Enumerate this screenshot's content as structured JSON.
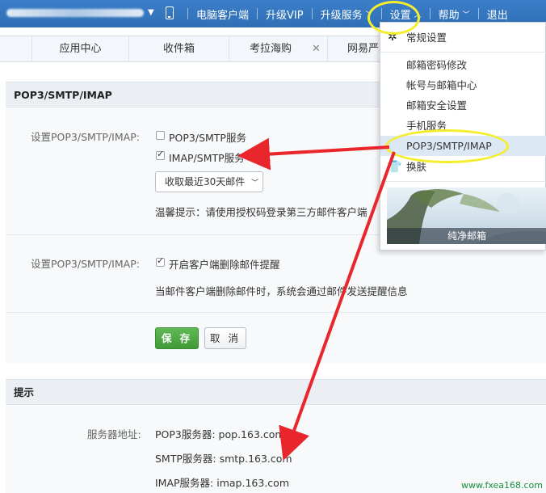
{
  "topbar": {
    "items": [
      {
        "label": "电脑客户端"
      },
      {
        "label": "升级VIP"
      },
      {
        "label": "升级服务"
      },
      {
        "label": "设置"
      },
      {
        "label": "帮助"
      },
      {
        "label": "退出"
      }
    ]
  },
  "tabs": [
    "应用中心",
    "收件箱",
    "考拉海购",
    "网易严"
  ],
  "pop_section": {
    "title": "POP3/SMTP/IMAP",
    "row1_label": "设置POP3/SMTP/IMAP:",
    "pop3_smtp_label": "POP3/SMTP服务",
    "pop3_smtp_checked": false,
    "imap_smtp_label": "IMAP/SMTP服务",
    "imap_smtp_checked": true,
    "fetch_select_value": "收取最近30天邮件",
    "tip": "温馨提示：请使用授权码登录第三方邮件客户端",
    "row2_label": "设置POP3/SMTP/IMAP:",
    "delete_notice_label": "开启客户端删除邮件提醒",
    "delete_notice_checked": true,
    "delete_notice_desc": "当邮件客户端删除邮件时，系统会通过邮件发送提醒信息",
    "save_label": "保 存",
    "cancel_label": "取 消"
  },
  "tips_section": {
    "title": "提示",
    "server_label": "服务器地址:",
    "pop3": "POP3服务器: pop.163.com",
    "smtp": "SMTP服务器: smtp.163.com",
    "imap": "IMAP服务器: imap.163.com"
  },
  "settings_menu": {
    "general": "常规设置",
    "items": [
      "邮箱密码修改",
      "帐号与邮箱中心",
      "邮箱安全设置",
      "手机服务",
      "POP3/SMTP/IMAP"
    ],
    "skin": "换肤",
    "skin_caption": "纯净邮箱"
  },
  "watermark": "www.fxea168.com",
  "colors": {
    "topbar": "#3577c0",
    "save_button": "#4aa842",
    "annotation_yellow": "#f4ee2c",
    "annotation_red": "#e8262b"
  }
}
